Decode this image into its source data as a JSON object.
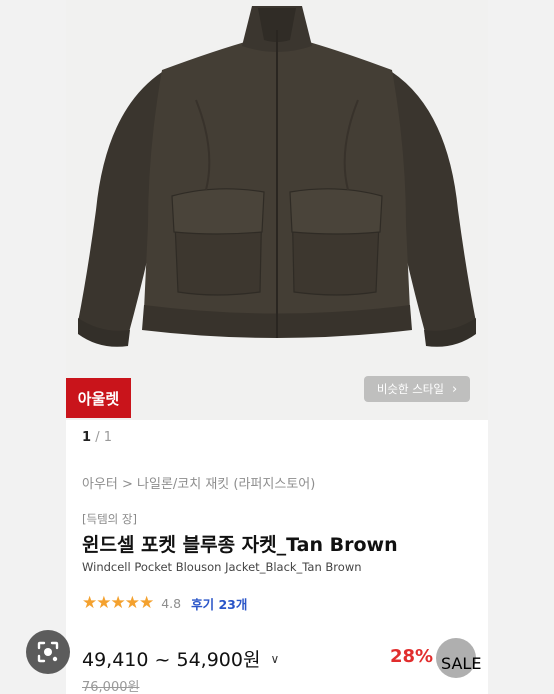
{
  "hero": {
    "badge": "아울렛",
    "similar_button": "비슷한 스타일",
    "similar_chevron": "›"
  },
  "pager": {
    "current": "1",
    "separator": "/",
    "total": "1"
  },
  "breadcrumb": "아우터 > 나일론/코치 재킷 (라퍼지스토어)",
  "product": {
    "tag": "[득템의 장]",
    "title_ko": "윈드셀 포켓 블루종 자켓_Tan Brown",
    "title_en": "Windcell Pocket Blouson Jacket_Black_Tan Brown"
  },
  "rating": {
    "stars": "★★★★★",
    "score": "4.8",
    "reviews": "후기 23개"
  },
  "price": {
    "range": "49,410 ~ 54,900원",
    "dropdown": "∨",
    "discount": "28%",
    "original": "76,000원",
    "sale_label": "SALE"
  },
  "colors": {
    "badge_bg": "#c9141b",
    "star": "#f4a12e",
    "review_link": "#2a55c8",
    "discount": "#e12d2d",
    "jacket": "#3f3a32"
  },
  "icons": [
    "lens-search-icon",
    "chevron-right-icon",
    "chevron-down-icon",
    "sale-icon"
  ]
}
